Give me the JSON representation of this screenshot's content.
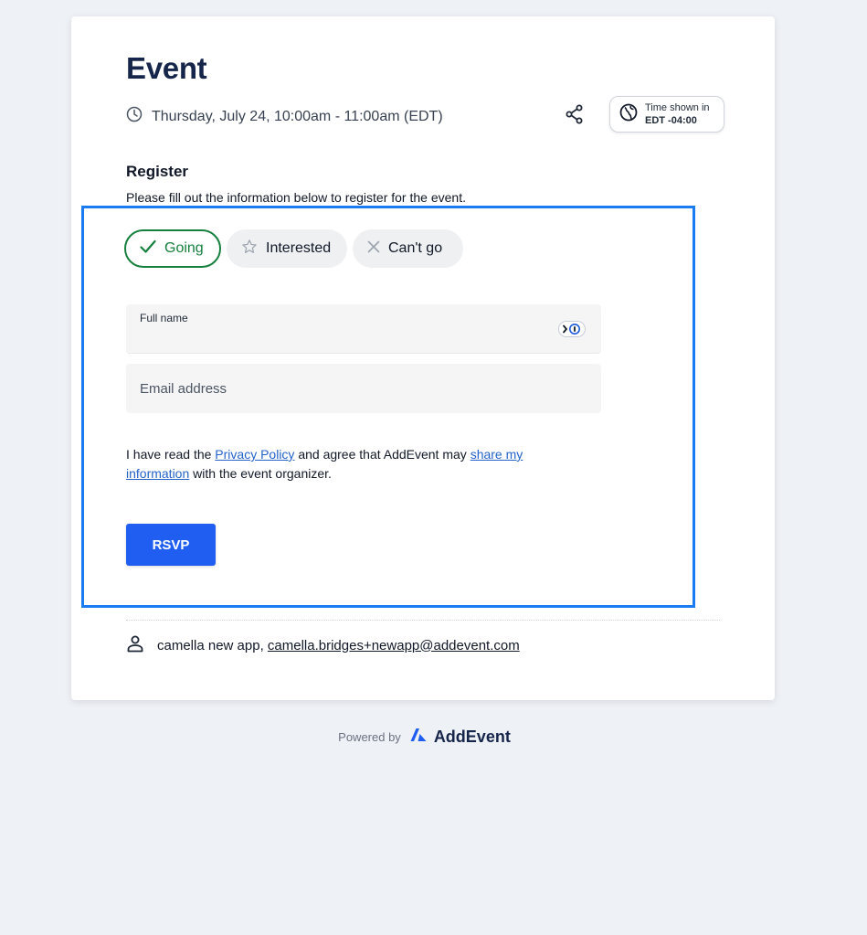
{
  "event": {
    "title": "Event",
    "datetime": "Thursday, July 24, 10:00am - 11:00am (EDT)"
  },
  "timezone": {
    "line1": "Time shown in",
    "line2": "EDT -04:00"
  },
  "register": {
    "heading": "Register",
    "description": "Please fill out the information below to register for the event."
  },
  "rsvp_options": {
    "going": "Going",
    "interested": "Interested",
    "cant_go": "Can't go",
    "selected": "Going"
  },
  "form": {
    "full_name_label": "Full name",
    "full_name_value": "",
    "email_placeholder": "Email address",
    "email_value": ""
  },
  "consent": {
    "prefix": "I have read the ",
    "privacy_link": "Privacy Policy",
    "middle": " and agree that AddEvent may ",
    "share_link": "share my information",
    "suffix": " with the event organizer."
  },
  "submit_label": "RSVP",
  "organizer": {
    "name": "camella new app,",
    "email": "camella.bridges+newapp@addevent.com"
  },
  "footer": {
    "powered_by": "Powered by",
    "brand": "AddEvent"
  },
  "colors": {
    "accent_blue": "#1f5ef0",
    "going_green": "#15803d",
    "highlight_outline": "#1a7cf0",
    "background": "#eef1f6"
  }
}
